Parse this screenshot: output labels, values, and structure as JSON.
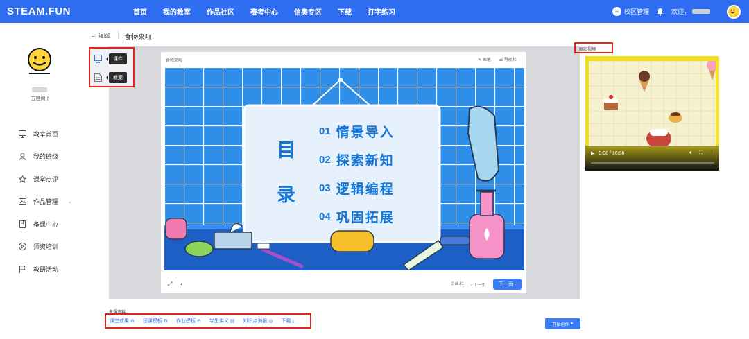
{
  "header": {
    "logo": "STEAM.FUN",
    "nav": [
      "首页",
      "我的教室",
      "作品社区",
      "赛考中心",
      "信奥专区",
      "下载",
      "打字练习"
    ],
    "campus_label": "校区管理",
    "welcome": "欢迎，"
  },
  "sidebar": {
    "org": "五桂阁下",
    "items": [
      {
        "label": "教室首页",
        "icon": "monitor-icon"
      },
      {
        "label": "我的班级",
        "icon": "user-icon"
      },
      {
        "label": "课堂点评",
        "icon": "star-icon"
      },
      {
        "label": "作品管理",
        "icon": "image-icon"
      },
      {
        "label": "备课中心",
        "icon": "book-icon"
      },
      {
        "label": "师资培训",
        "icon": "play-circle-icon"
      },
      {
        "label": "教研活动",
        "icon": "flag-icon"
      }
    ]
  },
  "page": {
    "back": "返回",
    "title": "食物来啦"
  },
  "tools": {
    "courseware": "课件",
    "lesson_plan": "教案"
  },
  "player": {
    "title": "食物来啦",
    "annotate": "画笔",
    "nav_bar": "导航栏",
    "page_indicator": "2 of 31",
    "prev": "上一页",
    "next": "下一页"
  },
  "slide": {
    "title_chars": [
      "目",
      "录"
    ],
    "items": [
      {
        "num": "01",
        "text": "情景导入"
      },
      {
        "num": "02",
        "text": "探索新知"
      },
      {
        "num": "03",
        "text": "逻辑编程"
      },
      {
        "num": "04",
        "text": "巩固拓展"
      }
    ]
  },
  "resources": {
    "label": "备课资料",
    "links": [
      "课堂成果",
      "授课模板",
      "作业模板",
      "学生讲义",
      "知识点海报",
      "下载"
    ]
  },
  "start_button": "开始创作",
  "video": {
    "label": "缩影视频",
    "time": "0:00 / 16:36",
    "progress": 0
  },
  "colors": {
    "brand": "#2f6df0",
    "highlight": "#e5241b",
    "slide_tile": "#2f8fe8"
  }
}
